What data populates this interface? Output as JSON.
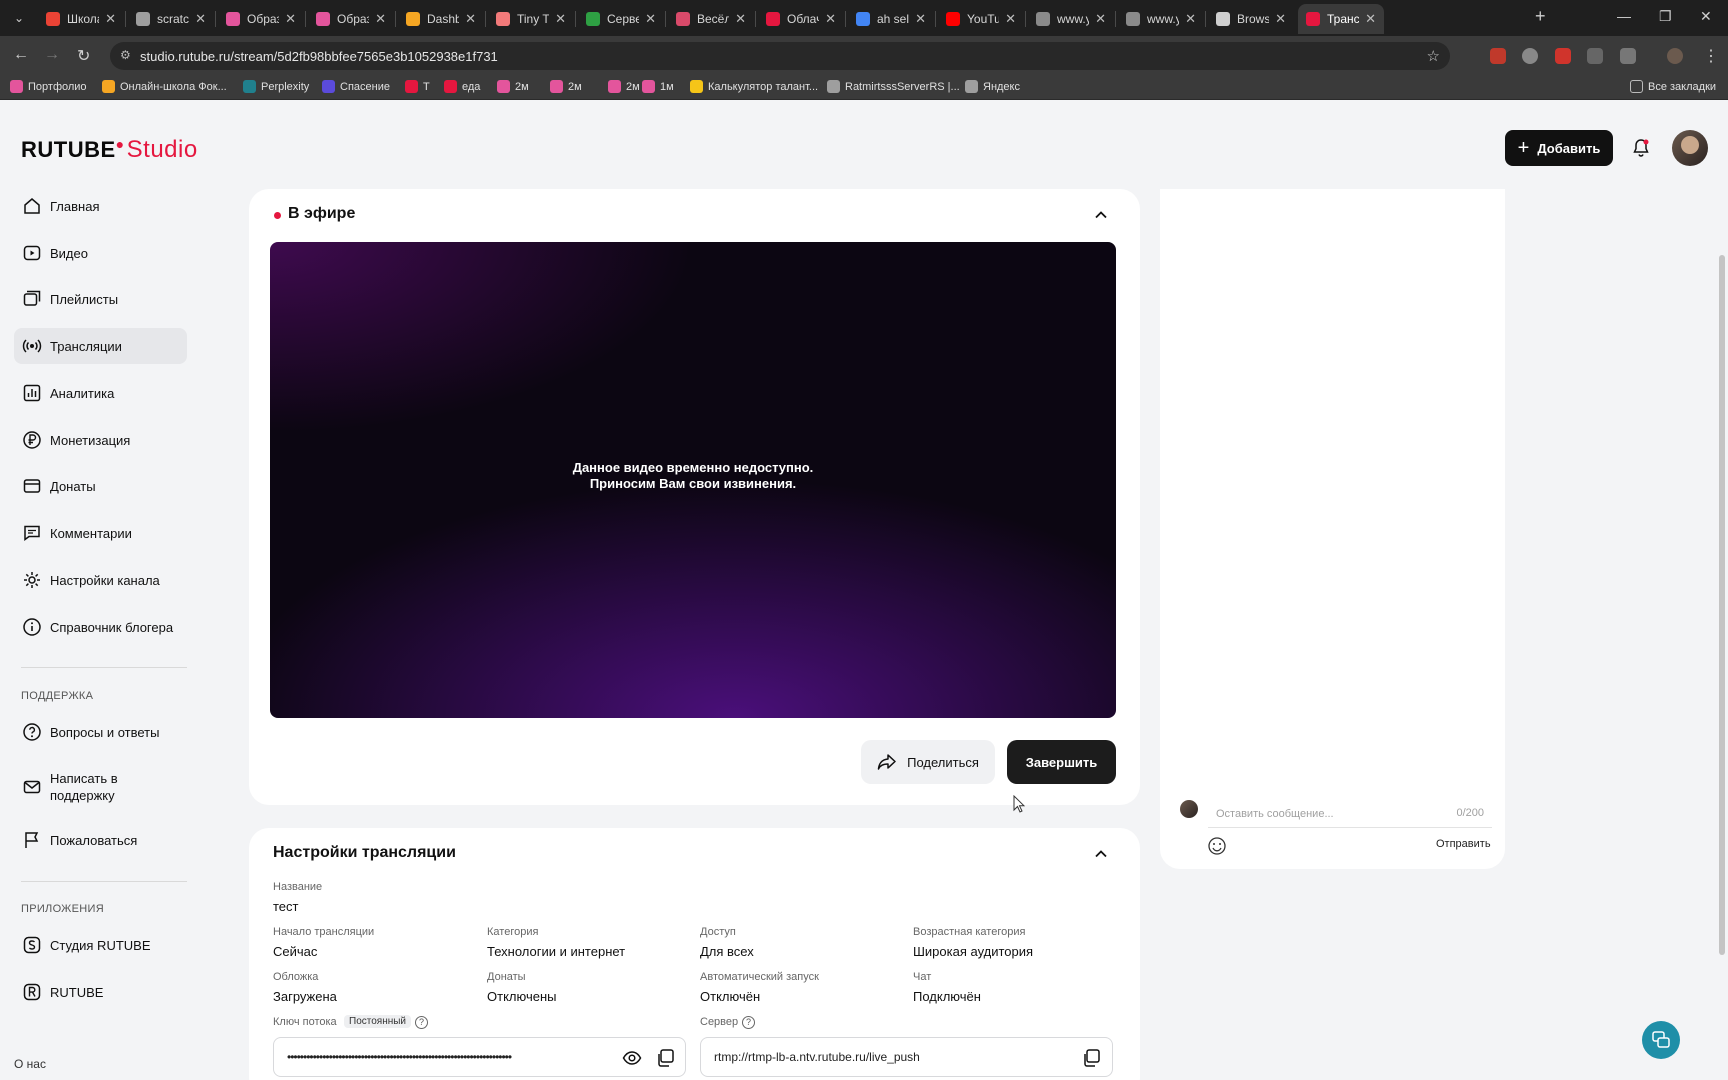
{
  "browser": {
    "tabs": [
      {
        "title": "Школа",
        "color": "#ea4335"
      },
      {
        "title": "scratch",
        "color": "#9e9e9e"
      },
      {
        "title": "Образ",
        "color": "#e3559c"
      },
      {
        "title": "Образ",
        "color": "#e3559c"
      },
      {
        "title": "Dashbo",
        "color": "#f5a623"
      },
      {
        "title": "Tiny Ty",
        "color": "#f27a7a"
      },
      {
        "title": "Сервер",
        "color": "#2ea043"
      },
      {
        "title": "Весёла",
        "color": "#d94a6a"
      },
      {
        "title": "Облачн",
        "color": "#e5173f"
      },
      {
        "title": "ah sell",
        "color": "#4285f4"
      },
      {
        "title": "YouTub",
        "color": "#ff0000"
      },
      {
        "title": "www.yo",
        "color": "#8a8a8a"
      },
      {
        "title": "www.yo",
        "color": "#8a8a8a"
      },
      {
        "title": "Browse",
        "color": "#cfcfcf"
      },
      {
        "title": "Трансл",
        "color": "#e5173f"
      }
    ],
    "url": "studio.rutube.ru/stream/5d2fb98bbfee7565e3b1052938e1f731",
    "bookmarks": [
      {
        "label": "Портфолио",
        "color": "#e3559c"
      },
      {
        "label": "Онлайн-школа Фок...",
        "color": "#f5a623"
      },
      {
        "label": "Perplexity",
        "color": "#20808d"
      },
      {
        "label": "Спасение",
        "color": "#5b4bdb"
      },
      {
        "label": "Т",
        "color": "#e5173f"
      },
      {
        "label": "еда",
        "color": "#e5173f"
      },
      {
        "label": "2м",
        "color": "#e3559c"
      },
      {
        "label": "2м",
        "color": "#e3559c"
      },
      {
        "label": "2м",
        "color": "#e3559c"
      },
      {
        "label": "1м",
        "color": "#e3559c"
      },
      {
        "label": "Калькулятор талант...",
        "color": "#f5c518"
      },
      {
        "label": "RatmirtsssServerRS |...",
        "color": "#9e9e9e"
      },
      {
        "label": "Яндекс",
        "color": "#9e9e9e"
      }
    ],
    "all_bookmarks": "Все закладки"
  },
  "header": {
    "logo_main": "RUTUBE",
    "logo_sub": "Studio",
    "add_label": "Добавить",
    "brand_color": "#e5173f"
  },
  "sidebar": {
    "items": [
      {
        "label": "Главная",
        "icon": "home-icon"
      },
      {
        "label": "Видео",
        "icon": "video-icon"
      },
      {
        "label": "Плейлисты",
        "icon": "playlist-icon"
      },
      {
        "label": "Трансляции",
        "icon": "broadcast-icon"
      },
      {
        "label": "Аналитика",
        "icon": "analytics-icon"
      },
      {
        "label": "Монетизация",
        "icon": "ruble-icon"
      },
      {
        "label": "Донаты",
        "icon": "donate-icon"
      },
      {
        "label": "Комментарии",
        "icon": "comments-icon"
      },
      {
        "label": "Настройки канала",
        "icon": "gear-icon"
      },
      {
        "label": "Справочник блогера",
        "icon": "info-icon"
      }
    ],
    "support_heading": "ПОДДЕРЖКА",
    "support": [
      {
        "label": "Вопросы и ответы",
        "icon": "help-icon"
      },
      {
        "label": "Написать в поддержку",
        "icon": "mail-icon"
      },
      {
        "label": "Пожаловаться",
        "icon": "flag-icon"
      }
    ],
    "apps_heading": "ПРИЛОЖЕНИЯ",
    "apps": [
      {
        "label": "Студия RUTUBE",
        "icon": "studio-app-icon"
      },
      {
        "label": "RUTUBE",
        "icon": "rutube-app-icon"
      }
    ],
    "about": "О нас"
  },
  "live": {
    "title": "В эфире",
    "player_line1": "Данное видео временно недоступно.",
    "player_line2": "Приносим Вам свои извинения.",
    "share_label": "Поделиться",
    "finish_label": "Завершить"
  },
  "settings": {
    "title": "Настройки трансляции",
    "name_label": "Название",
    "name_value": "тест",
    "fields": [
      {
        "label": "Начало трансляции",
        "value": "Сейчас"
      },
      {
        "label": "Категория",
        "value": "Технологии и интернет"
      },
      {
        "label": "Доступ",
        "value": "Для всех"
      },
      {
        "label": "Возрастная категория",
        "value": "Широкая аудитория"
      },
      {
        "label": "Обложка",
        "value": "Загружена"
      },
      {
        "label": "Донаты",
        "value": "Отключены"
      },
      {
        "label": "Автоматический запуск",
        "value": "Отключён"
      },
      {
        "label": "Чат",
        "value": "Подключён"
      }
    ],
    "stream_key_label": "Ключ потока",
    "stream_key_badge": "Постоянный",
    "stream_key_value": "••••••••••••••••••••••••••••••••••••••••••••••••••••••••••••••••••••••",
    "server_label": "Сервер",
    "server_value": "rtmp://rtmp-lb-a.ntv.rutube.ru/live_push"
  },
  "chat": {
    "placeholder": "Оставить сообщение...",
    "counter": "0/200",
    "send_label": "Отправить"
  }
}
